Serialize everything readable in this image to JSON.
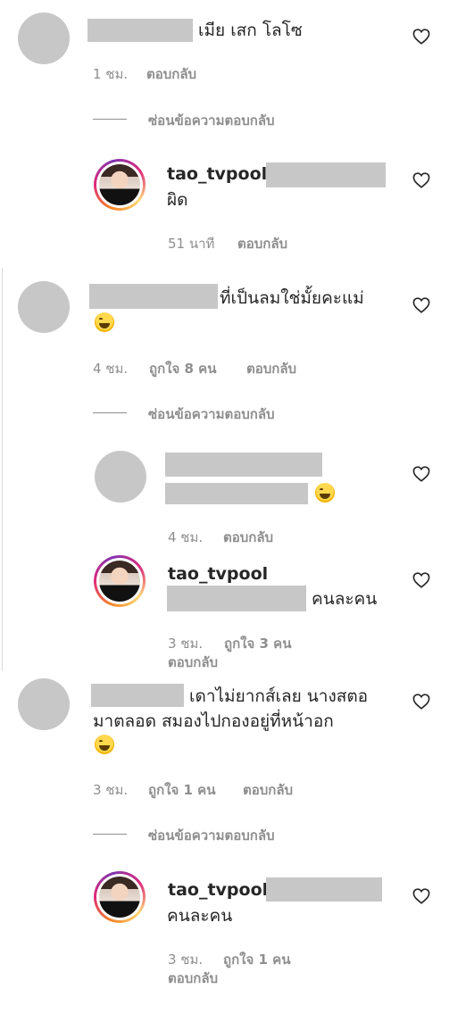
{
  "heart_icon": "heart-outline-icon",
  "comments": [
    {
      "text": "เมีย เสก โลโซ",
      "time": "1 ชม.",
      "reply": "ตอบกลับ",
      "hide_replies": "ซ่อนข้อความตอบกลับ",
      "replies": [
        {
          "username": "tao_tvpool",
          "text": "ผิด",
          "time": "51 นาที",
          "reply": "ตอบกลับ"
        }
      ]
    },
    {
      "text": "ที่เป็นลมใช่มั้ยคะแม่",
      "time": "4 ชม.",
      "likes": "ถูกใจ 8 คน",
      "reply": "ตอบกลับ",
      "hide_replies": "ซ่อนข้อความตอบกลับ",
      "replies": [
        {
          "time": "4 ชม.",
          "reply": "ตอบกลับ"
        },
        {
          "username": "tao_tvpool",
          "text": "คนละคน",
          "time": "3 ชม.",
          "likes": "ถูกใจ 3 คน",
          "reply": "ตอบกลับ"
        }
      ]
    },
    {
      "text_line1": "เดาไม่ยากส์เลย นางสตอ",
      "text_line2": "มาตลอด สมองไปกองอยู่ที่หน้าอก",
      "time": "3 ชม.",
      "likes": "ถูกใจ 1 คน",
      "reply": "ตอบกลับ",
      "hide_replies": "ซ่อนข้อความตอบกลับ",
      "replies": [
        {
          "username": "tao_tvpool",
          "text": "คนละคน",
          "time": "3 ชม.",
          "likes": "ถูกใจ 1 คน",
          "reply": "ตอบกลับ"
        }
      ]
    }
  ]
}
